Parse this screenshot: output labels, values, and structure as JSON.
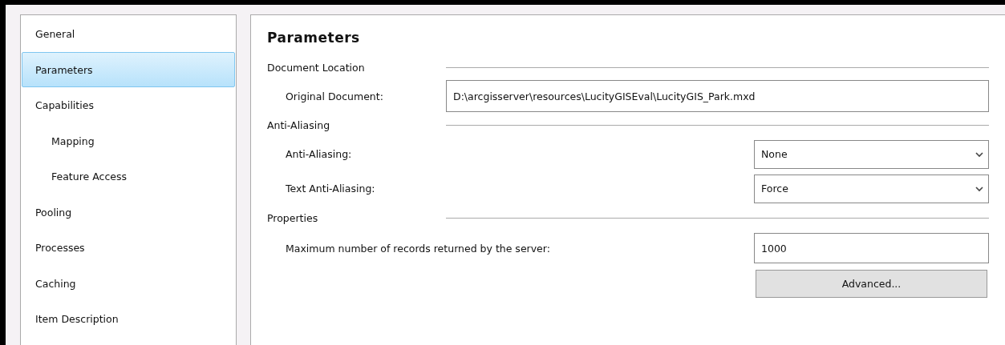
{
  "sidebar": {
    "items": [
      {
        "label": "General",
        "selected": false
      },
      {
        "label": "Parameters",
        "selected": true
      },
      {
        "label": "Capabilities",
        "selected": false,
        "children": [
          {
            "label": "Mapping",
            "selected": false
          },
          {
            "label": "Feature Access",
            "selected": false
          }
        ]
      },
      {
        "label": "Pooling",
        "selected": false
      },
      {
        "label": "Processes",
        "selected": false
      },
      {
        "label": "Caching",
        "selected": false
      },
      {
        "label": "Item Description",
        "selected": false
      }
    ]
  },
  "main": {
    "title": "Parameters",
    "sections": [
      {
        "title": "Document Location",
        "fields": [
          {
            "kind": "text-wide",
            "label": "Original Document:",
            "value": "D:\\arcgisserver\\resources\\LucityGISEval\\LucityGIS_Park.mxd"
          }
        ]
      },
      {
        "title": "Anti-Aliasing",
        "fields": [
          {
            "kind": "select",
            "label": "Anti-Aliasing:",
            "value": "None"
          },
          {
            "kind": "select",
            "label": "Text Anti-Aliasing:",
            "value": "Force"
          }
        ]
      },
      {
        "title": "Properties",
        "fields": [
          {
            "kind": "text",
            "label": "Maximum number of records returned by the server:",
            "value": "1000"
          },
          {
            "kind": "button",
            "label": "Advanced..."
          }
        ]
      }
    ]
  }
}
